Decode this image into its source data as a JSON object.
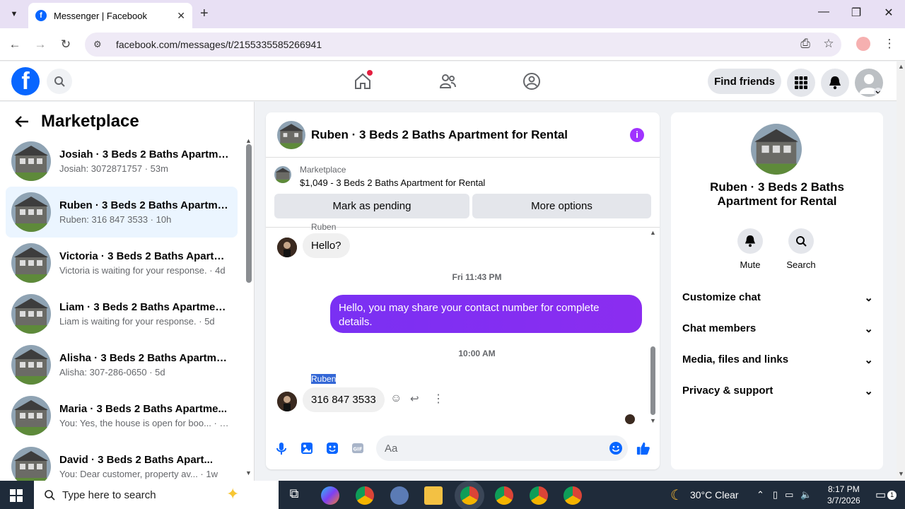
{
  "browser": {
    "tab_title": "Messenger | Facebook",
    "url": "facebook.com/messages/t/2155335585266941"
  },
  "fb": {
    "find_friends": "Find friends"
  },
  "sidebar": {
    "title": "Marketplace",
    "conversations": [
      {
        "name": "Josiah · 3 Beds 2 Baths Apartme...",
        "preview": "Josiah: 3072871757 · 53m"
      },
      {
        "name": "Ruben · 3 Beds 2 Baths Apartme...",
        "preview": "Ruben: 316 847 3533 · 10h"
      },
      {
        "name": "Victoria · 3 Beds 2 Baths Apartm...",
        "preview": "Victoria is waiting for your response. · 4d"
      },
      {
        "name": "Liam · 3 Beds 2 Baths Apartmen...",
        "preview": "Liam is waiting for your response. · 5d"
      },
      {
        "name": "Alisha · 3 Beds 2 Baths Apartme...",
        "preview": "Alisha: 307-286-0650 · 5d"
      },
      {
        "name": "Maria · 3 Beds 2 Baths Apartme...",
        "preview": "You: Yes, the house is open for boo... · 1w"
      },
      {
        "name": "David · 3 Beds 2 Baths Apart...",
        "preview": "You: Dear customer, property av... · 1w"
      }
    ]
  },
  "chat": {
    "title": "Ruben · 3 Beds 2 Baths Apartment for Rental",
    "marketplace_label": "Marketplace",
    "listing": "$1,049 - 3 Beds 2 Baths Apartment for Rental",
    "mark_pending": "Mark as pending",
    "more_options": "More options",
    "sender_partial": "Ruben",
    "msg1": "Hello?",
    "ts1": "Fri 11:43 PM",
    "msg2": "Hello, you may share your contact number for complete details.",
    "ts2": "10:00 AM",
    "sender": "Ruben",
    "msg3": "316 847 3533",
    "composer_placeholder": "Aa"
  },
  "details": {
    "name": "Ruben · 3 Beds 2 Baths Apartment for Rental",
    "mute": "Mute",
    "search": "Search",
    "sections": [
      "Customize chat",
      "Chat members",
      "Media, files and links",
      "Privacy & support"
    ]
  },
  "taskbar": {
    "search_placeholder": "Type here to search",
    "weather": "30°C  Clear",
    "time": "8:17 PM",
    "date": "3/7/2026",
    "notif_count": "1"
  }
}
